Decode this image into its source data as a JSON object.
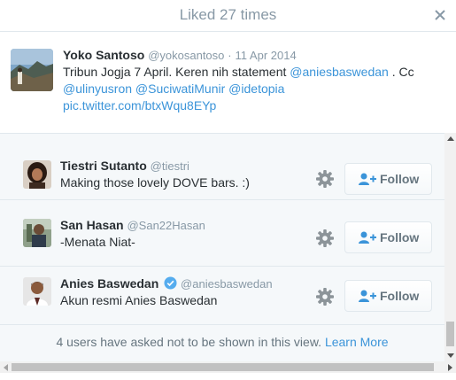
{
  "modal": {
    "title": "Liked 27 times",
    "close_icon": "close-icon"
  },
  "tweet": {
    "fullname": "Yoko Santoso",
    "screen_name": "@yokosantoso",
    "separator": "·",
    "date": "11 Apr 2014",
    "text_part1": "Tribun Jogja 7 April. Keren nih statement ",
    "mention1": "@aniesbaswedan",
    "text_part2": " . Cc",
    "mention2": "@ulinyusron",
    "mention3": "@SuciwatiMunir",
    "mention4": "@idetopia",
    "pic_link": "pic.twitter.com/btxWqu8EYp"
  },
  "users": [
    {
      "name": "Tiestri Sutanto",
      "handle": "@tiestri",
      "bio": "Making those lovely DOVE bars. :)",
      "verified": false,
      "follow_label": "Follow"
    },
    {
      "name": "San Hasan",
      "handle": "@San22Hasan",
      "bio": "-Menata Niat-",
      "verified": false,
      "follow_label": "Follow"
    },
    {
      "name": "Anies Baswedan",
      "handle": "@aniesbaswedan",
      "bio": "Akun resmi Anies Baswedan",
      "verified": true,
      "follow_label": "Follow"
    }
  ],
  "footer": {
    "note": "4 users have asked not to be shown in this view.",
    "learn_more": "Learn More"
  },
  "colors": {
    "link": "#3b94d9",
    "muted": "#8899a6",
    "text": "#292f33",
    "verified_badge": "#55acee"
  },
  "icons": [
    "close-icon",
    "gear-icon",
    "follow-person-plus-icon",
    "verified-badge-icon"
  ]
}
